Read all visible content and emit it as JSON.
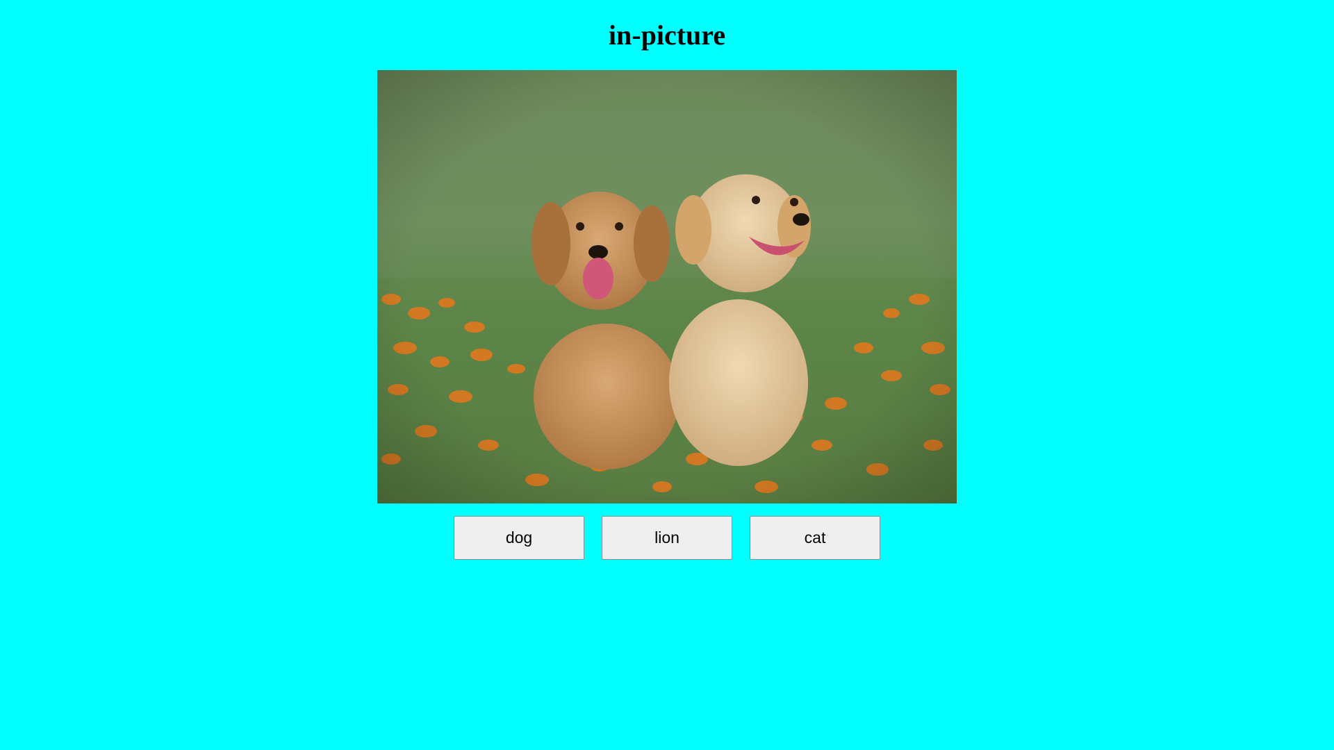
{
  "page": {
    "title": "in-picture",
    "background_color": "#00FFFF"
  },
  "quiz": {
    "image_subject": "two golden retriever puppies sitting in grass with orange flowers",
    "options": [
      {
        "label": "dog"
      },
      {
        "label": "lion"
      },
      {
        "label": "cat"
      }
    ]
  }
}
